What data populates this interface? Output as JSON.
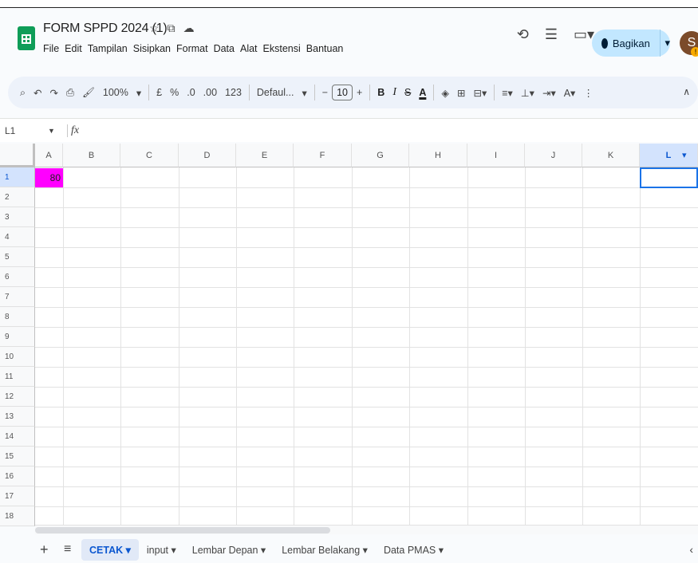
{
  "app": {
    "title": "FORM SPPD 2024 (1)",
    "menus": [
      "File",
      "Edit",
      "Tampilan",
      "Sisipkan",
      "Format",
      "Data",
      "Alat",
      "Ekstensi",
      "Bantuan"
    ],
    "share_label": "Bagikan",
    "avatar_letter": "S"
  },
  "toolbar": {
    "zoom": "100%",
    "currency": "£",
    "percent": "%",
    "dec_less": ".0",
    "dec_more": ".00",
    "num_format": "123",
    "font": "Defaul...",
    "font_size": "10",
    "minus": "−",
    "plus": "+",
    "bold": "B",
    "italic": "I",
    "strike": "S",
    "text_color": "A"
  },
  "formula_bar": {
    "name_box": "L1",
    "fx": "fx",
    "value": ""
  },
  "grid": {
    "columns": [
      "A",
      "B",
      "C",
      "D",
      "E",
      "F",
      "G",
      "H",
      "I",
      "J",
      "K",
      "L"
    ],
    "rows": [
      "1",
      "2",
      "3",
      "4",
      "5",
      "6",
      "7",
      "8",
      "9",
      "10",
      "11",
      "12",
      "13",
      "14",
      "15",
      "16",
      "17",
      "18"
    ],
    "cell_A1": "80",
    "cell_A1_color": "#ff00ff",
    "selected_cell": "L1"
  },
  "sheets": {
    "tabs": [
      "CETAK",
      "input",
      "Lembar Depan",
      "Lembar Belakang",
      "Data PMAS"
    ],
    "active": "CETAK"
  },
  "colors": {
    "accent": "#0b57d0",
    "share_bg": "#c2e7ff",
    "logo": "#0f9d58"
  }
}
